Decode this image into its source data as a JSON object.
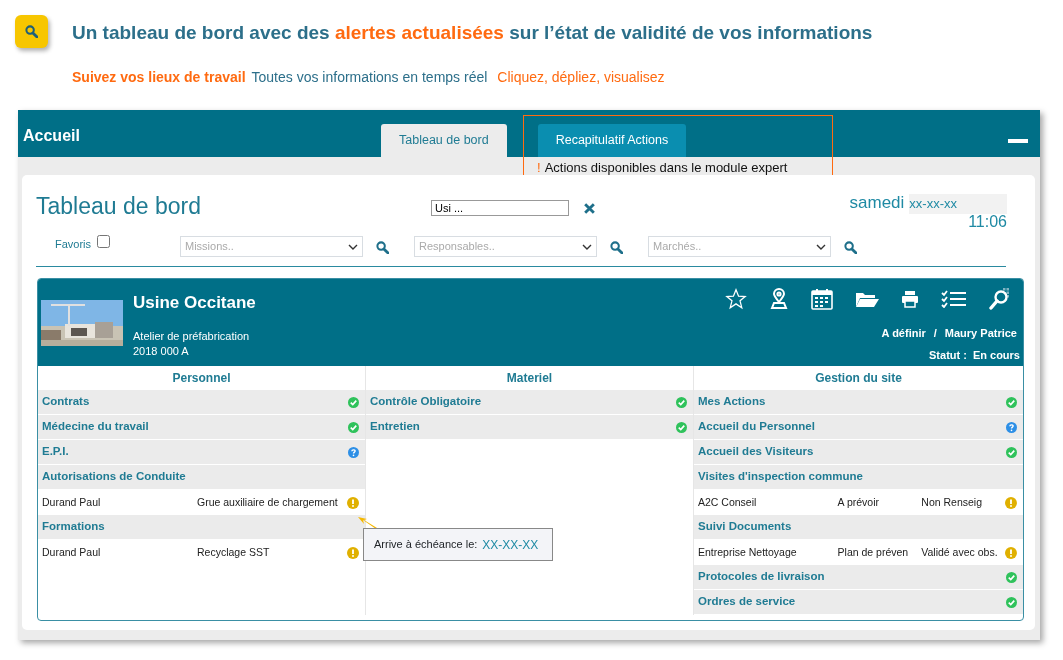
{
  "banner": {
    "headline": [
      {
        "text": "Un tableau de bord avec des ",
        "highlight": false
      },
      {
        "text": "alertes actualisées",
        "highlight": true
      },
      {
        "text": " sur l’état de validité de vos informations",
        "highlight": false
      }
    ],
    "subline": [
      {
        "text": "Suivez vos lieux de travail",
        "kind": "strong"
      },
      {
        "text": "Toutes vos informations en temps réel",
        "kind": "plain"
      },
      {
        "text": "Cliquez, dépliez, visualisez",
        "kind": "accent"
      }
    ]
  },
  "app": {
    "title": "Accueil",
    "tabs": [
      {
        "label": "Tableau de bord",
        "selected": true,
        "highlighted": false
      },
      {
        "label": "Recapitulatif Actions",
        "selected": false,
        "highlighted": true,
        "note_mark": "!",
        "note": "Actions disponibles dans le module expert"
      }
    ]
  },
  "dashboard": {
    "title": "Tableau de bord",
    "search": {
      "value": "Usi ..."
    },
    "day": "samedi",
    "date": "xx-xx-xx",
    "time": "11:06",
    "favorites": {
      "label": "Favoris",
      "checked": false
    },
    "filters": [
      {
        "placeholder": "Missions.."
      },
      {
        "placeholder": "Responsables.."
      },
      {
        "placeholder": "Marchés.."
      }
    ]
  },
  "site": {
    "name": "Usine Occitane",
    "subtitle": "Atelier de préfabrication",
    "code": "2018 000 A",
    "assignee": "A définir",
    "separator": "/",
    "manager": "Maury Patrice",
    "status_label": "Statut :",
    "status": "En cours"
  },
  "columns": [
    {
      "heading": "Personnel",
      "rows": [
        {
          "kind": "section",
          "label": "Contrats",
          "badge": {
            "kind": "ok"
          }
        },
        {
          "kind": "section",
          "label": "Médecine du travail",
          "badge": {
            "kind": "ok"
          }
        },
        {
          "kind": "section",
          "label": "E.P.I.",
          "badge": {
            "kind": "info"
          }
        },
        {
          "kind": "section",
          "label": "Autorisations de Conduite"
        },
        {
          "kind": "entry",
          "cells": [
            "Durand Paul",
            "Grue auxiliaire de chargement"
          ],
          "badge": {
            "kind": "warn"
          }
        },
        {
          "kind": "section",
          "label": "Formations"
        },
        {
          "kind": "entry",
          "cells": [
            "Durand Paul",
            "Recyclage SST"
          ],
          "badge": {
            "kind": "warn"
          }
        }
      ]
    },
    {
      "heading": "Materiel",
      "rows": [
        {
          "kind": "section",
          "label": "Contrôle Obligatoire",
          "badge": {
            "kind": "ok"
          }
        },
        {
          "kind": "section",
          "label": "Entretien",
          "badge": {
            "kind": "ok"
          }
        }
      ]
    },
    {
      "heading": "Gestion du site",
      "rows": [
        {
          "kind": "section",
          "label": "Mes Actions",
          "badge": {
            "kind": "ok"
          }
        },
        {
          "kind": "section",
          "label": "Accueil du Personnel",
          "badge": {
            "kind": "info"
          }
        },
        {
          "kind": "section",
          "label": "Accueil des Visiteurs",
          "badge": {
            "kind": "ok"
          }
        },
        {
          "kind": "section",
          "label": "Visites d'inspection commune"
        },
        {
          "kind": "entry",
          "cells": [
            "A2C Conseil",
            "A prévoir",
            "Non Renseig"
          ],
          "badge": {
            "kind": "warn"
          }
        },
        {
          "kind": "section",
          "label": "Suivi Documents"
        },
        {
          "kind": "entry",
          "cells": [
            "Entreprise Nettoyage",
            "Plan de préven",
            "Validé avec obs."
          ],
          "badge": {
            "kind": "warn"
          }
        },
        {
          "kind": "section",
          "label": "Protocoles de livraison",
          "badge": {
            "kind": "ok"
          }
        },
        {
          "kind": "section",
          "label": "Ordres de service",
          "badge": {
            "kind": "ok"
          }
        }
      ]
    }
  ],
  "tooltip": {
    "label": "Arrive à échéance le:",
    "value": "XX-XX-XX"
  }
}
